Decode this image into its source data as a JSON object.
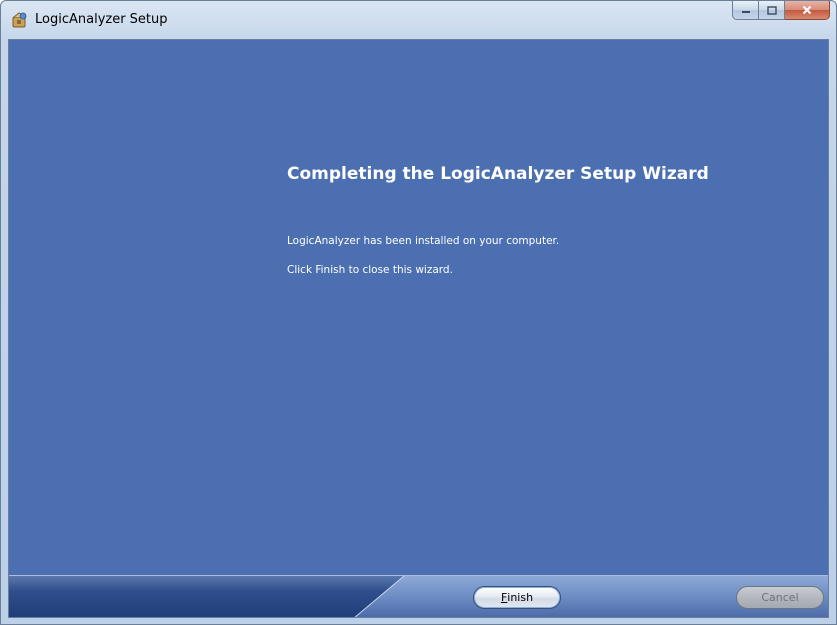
{
  "window": {
    "title": "LogicAnalyzer Setup",
    "app_icon": "installer-icon"
  },
  "caption_buttons": {
    "minimize": "minimize-icon",
    "maximize": "maximize-icon",
    "close": "close-icon"
  },
  "wizard": {
    "heading": "Completing the LogicAnalyzer Setup Wizard",
    "line1": "LogicAnalyzer has been installed on your computer.",
    "line2": "Click Finish to close this wizard."
  },
  "buttons": {
    "finish_accel": "F",
    "finish_rest": "inish",
    "cancel": "Cancel",
    "cancel_enabled": false
  },
  "colors": {
    "panel_background": "#4b6fb0",
    "bottom_bar": "#1f3d78",
    "text": "#ffffff"
  }
}
